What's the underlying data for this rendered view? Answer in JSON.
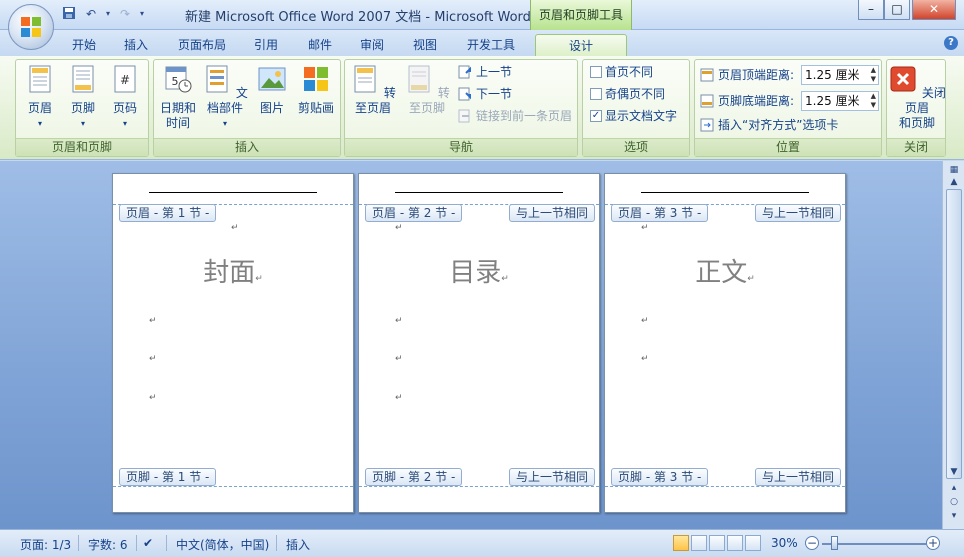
{
  "window": {
    "title": "新建 Microsoft Office Word 2007 文档 - Microsoft Word",
    "contextual_tools_title": "页眉和页脚工具",
    "controls": {
      "minimize": "–",
      "maximize": "□",
      "close": "✕"
    }
  },
  "quick_access": {
    "save_icon": "save-icon",
    "undo_icon": "undo-icon",
    "redo_icon": "redo-icon",
    "more": "▾"
  },
  "tabs": [
    "开始",
    "插入",
    "页面布局",
    "引用",
    "邮件",
    "审阅",
    "视图",
    "开发工具",
    "设计"
  ],
  "active_tab": "设计",
  "ribbon": {
    "groups": {
      "header_footer": {
        "label": "页眉和页脚",
        "buttons": [
          {
            "label": "页眉",
            "icon": "header-icon"
          },
          {
            "label": "页脚",
            "icon": "footer-icon"
          },
          {
            "label": "页码",
            "icon": "page-number-icon"
          }
        ]
      },
      "insert": {
        "label": "插入",
        "buttons": [
          {
            "label1": "日期和",
            "label2": "时间",
            "icon": "date-time-icon"
          },
          {
            "label1": "文档部件",
            "icon": "quick-parts-icon"
          },
          {
            "label1": "图片",
            "icon": "picture-icon"
          },
          {
            "label1": "剪贴画",
            "icon": "clipart-icon"
          }
        ]
      },
      "navigation": {
        "label": "导航",
        "goto_header": "转至页眉",
        "goto_footer": "转至页脚",
        "prev_section": "上一节",
        "next_section": "下一节",
        "link_previous": "链接到前一条页眉"
      },
      "options": {
        "label": "选项",
        "different_first_page": "首页不同",
        "different_odd_even": "奇偶页不同",
        "show_document_text": "显示文档文字",
        "show_document_text_checked": true
      },
      "position": {
        "label": "位置",
        "header_from_top_label": "页眉顶端距离:",
        "header_from_top_value": "1.25 厘米",
        "footer_from_bottom_label": "页脚底端距离:",
        "footer_from_bottom_value": "1.25 厘米",
        "insert_alignment_tab": "插入“对齐方式”选项卡"
      },
      "close": {
        "label": "关闭",
        "button_line1": "关闭页眉",
        "button_line2": "和页脚"
      }
    }
  },
  "pages": [
    {
      "title": "封面",
      "header_tag": "页眉 - 第 1 节 -",
      "footer_tag": "页脚 - 第 1 节 -",
      "same_as_prev": ""
    },
    {
      "title": "目录",
      "header_tag": "页眉 - 第 2 节 -",
      "footer_tag": "页脚 - 第 2 节 -",
      "same_as_prev": "与上一节相同"
    },
    {
      "title": "正文",
      "header_tag": "页眉 - 第 3 节 -",
      "footer_tag": "页脚 - 第 3 节 -",
      "same_as_prev": "与上一节相同"
    }
  ],
  "paragraph_mark": "↵",
  "status": {
    "page": "页面: 1/3",
    "words": "字数: 6",
    "language": "中文(简体，中国)",
    "mode": "插入",
    "zoom": "30%",
    "zoom_percent": 30
  },
  "colors": {
    "ribbon_contextual": "#ddf0c9",
    "close_red": "#d0442a",
    "doc_background": "#7fa3d6"
  }
}
